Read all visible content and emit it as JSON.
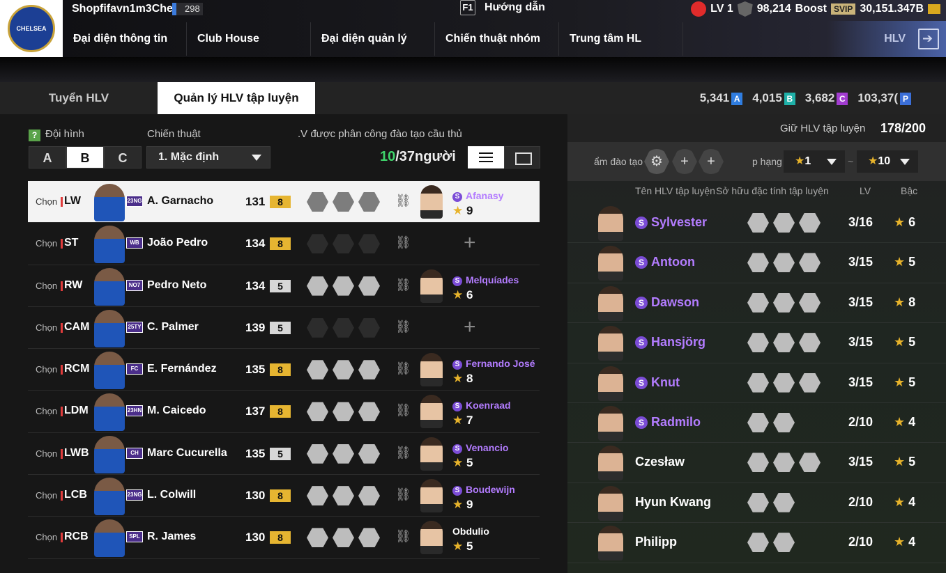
{
  "topbar": {
    "team_name": "Shopfifavn1m3Che",
    "team_level": "298",
    "f1_key": "F1",
    "guide": "Hướng dẫn",
    "level": "LV 1",
    "shield_value": "98,214",
    "boost_label": "Boost",
    "svip": "SVIP",
    "coins": "30,151.347B",
    "hlv": "HLV"
  },
  "nav": {
    "items": [
      "Đại diện thông tin đội",
      "Club House",
      "Đại diện quản lý đội",
      "Chiến thuật nhóm",
      "Trung tâm HL"
    ]
  },
  "tabs": {
    "recruit": "Tuyển HLV",
    "manage": "Quản lý HLV tập luyện"
  },
  "currencies": [
    {
      "value": "5,341",
      "badge": "A",
      "color": "#2f7de0"
    },
    {
      "value": "4,015",
      "badge": "B",
      "color": "#1fb0a8"
    },
    {
      "value": "3,682",
      "badge": "C",
      "color": "#a23cd0"
    },
    {
      "value": "103,37(",
      "badge": "P",
      "color": "#3b6fd8"
    }
  ],
  "left": {
    "help": "?",
    "formation_label": "Đội hình",
    "tactic_label": "Chiến thuật",
    "assign_label": ".V được phân công đào tạo cầu thủ",
    "formations": [
      "A",
      "B",
      "C"
    ],
    "tactic": "1. Mặc định",
    "count_green": "10",
    "count_rest": "/37người"
  },
  "players": [
    {
      "chon": "Chọn",
      "pos": "LW",
      "card": "23NG",
      "name": "A. Garnacho",
      "ovr": "131",
      "grade": "8",
      "coach": "Afanasy",
      "stars": "9",
      "s": true
    },
    {
      "chon": "Chọn",
      "pos": "ST",
      "card": "WB",
      "name": "João Pedro",
      "ovr": "134",
      "grade": "8",
      "coach": "",
      "stars": "",
      "s": false
    },
    {
      "chon": "Chọn",
      "pos": "RW",
      "card": "NO7",
      "name": "Pedro Neto",
      "ovr": "134",
      "grade": "5",
      "coach": "Melquíades",
      "stars": "6",
      "s": true
    },
    {
      "chon": "Chọn",
      "pos": "CAM",
      "card": "25TY",
      "name": "C. Palmer",
      "ovr": "139",
      "grade": "5",
      "coach": "",
      "stars": "",
      "s": false
    },
    {
      "chon": "Chọn",
      "pos": "RCM",
      "card": "FC",
      "name": "E. Fernández",
      "ovr": "135",
      "grade": "8",
      "coach": "Fernando José",
      "stars": "8",
      "s": true
    },
    {
      "chon": "Chọn",
      "pos": "LDM",
      "card": "23HN",
      "name": "M. Caicedo",
      "ovr": "137",
      "grade": "8",
      "coach": "Koenraad",
      "stars": "7",
      "s": true
    },
    {
      "chon": "Chọn",
      "pos": "LWB",
      "card": "CH",
      "name": "Marc Cucurella",
      "ovr": "135",
      "grade": "5",
      "coach": "Venancio",
      "stars": "5",
      "s": true
    },
    {
      "chon": "Chọn",
      "pos": "LCB",
      "card": "23NG",
      "name": "L. Colwill",
      "ovr": "130",
      "grade": "8",
      "coach": "Boudewijn",
      "stars": "9",
      "s": true
    },
    {
      "chon": "Chọn",
      "pos": "RCB",
      "card": "SPL",
      "name": "R. James",
      "ovr": "130",
      "grade": "8",
      "coach": "Obdulio",
      "stars": "5",
      "s": false
    }
  ],
  "right": {
    "hold_label": "Giữ HLV tập luyện",
    "hold_value": "178/200",
    "filter_label": "ẩm đào tạo",
    "rank_label": "p hạng",
    "rank_from": "1",
    "rank_to": "10",
    "tilde": "~",
    "plus": "+",
    "headers": {
      "name": "Tên HLV tập luyện",
      "traits": "Sở hữu đặc tính tập luyện",
      "lv": "LV",
      "rank": "Bậc"
    }
  },
  "coaches": [
    {
      "name": "Sylvester",
      "lv": "3/16",
      "rank": "6",
      "s": true,
      "n": 3
    },
    {
      "name": "Antoon",
      "lv": "3/15",
      "rank": "5",
      "s": true,
      "n": 3
    },
    {
      "name": "Dawson",
      "lv": "3/15",
      "rank": "8",
      "s": true,
      "n": 3
    },
    {
      "name": "Hansjörg",
      "lv": "3/15",
      "rank": "5",
      "s": true,
      "n": 3
    },
    {
      "name": "Knut",
      "lv": "3/15",
      "rank": "5",
      "s": true,
      "n": 3
    },
    {
      "name": "Radmilo",
      "lv": "2/10",
      "rank": "4",
      "s": true,
      "n": 2
    },
    {
      "name": "Czesław",
      "lv": "3/15",
      "rank": "5",
      "s": false,
      "n": 3
    },
    {
      "name": "Hyun Kwang",
      "lv": "2/10",
      "rank": "4",
      "s": false,
      "n": 2
    },
    {
      "name": "Philipp",
      "lv": "2/10",
      "rank": "4",
      "s": false,
      "n": 2
    }
  ],
  "colors": {
    "grade8": "#e6b531",
    "grade5": "#d7d7d7",
    "purple": "#b37cff",
    "green": "#3fd46b"
  }
}
